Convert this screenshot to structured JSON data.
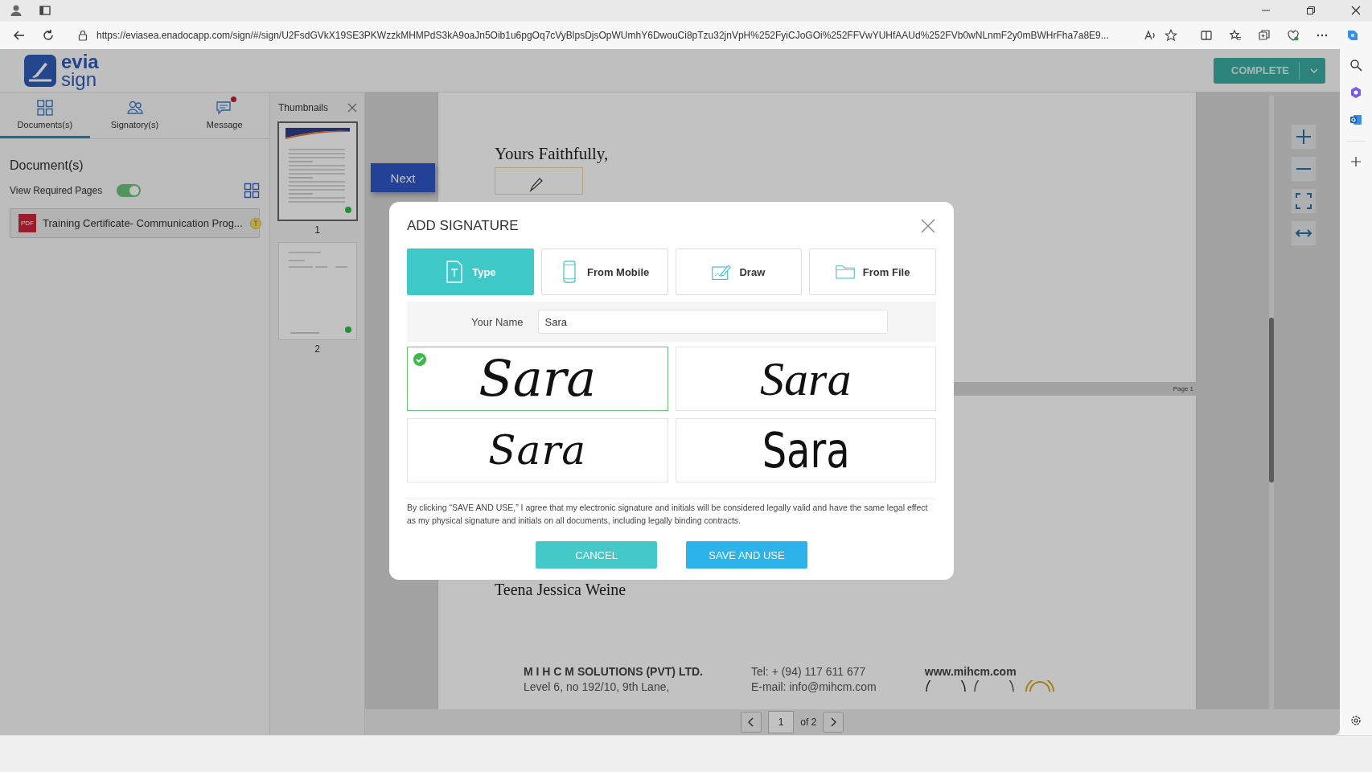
{
  "browser": {
    "url": "https://eviasea.enadocapp.com/sign/#/sign/U2FsdGVkX19SE3PKWzzkMHMPdS3kA9oaJn5Oib1u6pgOq7cVyBlpsDjsOpWUmhY6DwouCi8pTzu32jnVpH%252FyiCJoGOi%252FFVwYUHfAAUd%252FVb0wNLnmF2y0mBWHrFha7a8E9..."
  },
  "header": {
    "logo_top": "evia",
    "logo_bottom": "sign",
    "complete_button": "COMPLETE"
  },
  "side_tabs": [
    {
      "label": "Documents(s)",
      "kind": "grid",
      "selected": true,
      "badge": false
    },
    {
      "label": "Signatory(s)",
      "kind": "people",
      "selected": false,
      "badge": false
    },
    {
      "label": "Message",
      "kind": "chat",
      "selected": false,
      "badge": true
    }
  ],
  "documents": {
    "heading": "Document(s)",
    "view_required": {
      "label": "View Required Pages",
      "on": true
    },
    "items": [
      {
        "name": "Training Certificate- Communication Prog...",
        "file_type": "PDF"
      }
    ]
  },
  "thumbnails": {
    "title": "Thumbnails",
    "pages": [
      {
        "label": "1",
        "complete": true,
        "selected": true,
        "kind": "letter"
      },
      {
        "label": "2",
        "complete": true,
        "selected": false,
        "kind": "sign"
      }
    ]
  },
  "document": {
    "next_button": "Next",
    "closing": "Yours Faithfully,",
    "page_label": "Page 1",
    "signer": "Teena Jessica Weine",
    "footer": {
      "company": "M I H C M SOLUTIONS (PVT) LTD.",
      "address": "Level 6, no 192/10, 9th Lane,",
      "tel": "Tel:  + (94) 117 611 677",
      "email": "E-mail: info@mihcm.com",
      "website": "www.mihcm.com"
    }
  },
  "pagination": {
    "page": "1",
    "total": "of 2"
  },
  "dialog": {
    "title": "ADD SIGNATURE",
    "tabs": [
      {
        "label": "Type",
        "kind": "type",
        "selected": true
      },
      {
        "label": "From Mobile",
        "kind": "mobile",
        "selected": false
      },
      {
        "label": "Draw",
        "kind": "draw",
        "selected": false
      },
      {
        "label": "From File",
        "kind": "file",
        "selected": false
      }
    ],
    "name_label": "Your Name",
    "name_value": "Sara",
    "signatures": [
      {
        "text": "Sara",
        "selected": true
      },
      {
        "text": "Sara",
        "selected": false
      },
      {
        "text": "Sara",
        "selected": false
      },
      {
        "text": "Sara",
        "selected": false
      }
    ],
    "consent": "By clicking “SAVE AND USE,” I agree that my electronic signature and initials will be considered legally valid and have the same legal effect as my physical signature and initials on all documents, including legally binding contracts.",
    "cancel": "CANCEL",
    "save": "SAVE AND USE"
  }
}
